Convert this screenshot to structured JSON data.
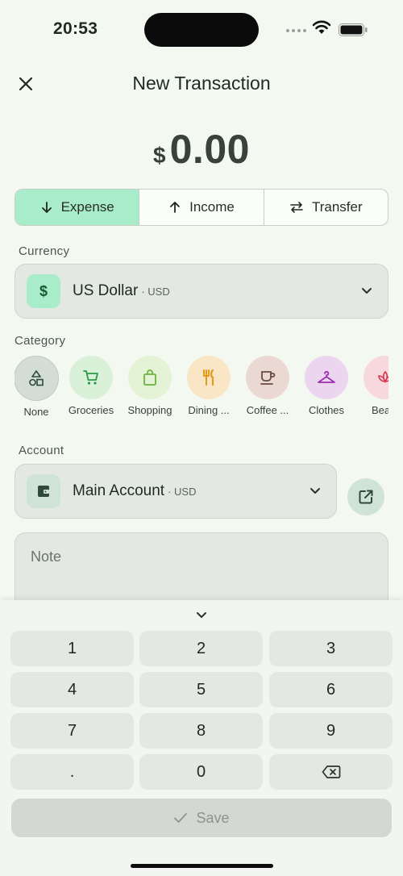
{
  "status": {
    "time": "20:53"
  },
  "header": {
    "title": "New Transaction",
    "close_icon": "close-icon"
  },
  "amount": {
    "currency_symbol": "$",
    "value": "0.00"
  },
  "types": [
    {
      "label": "Expense",
      "icon": "arrow-down-icon",
      "active": true
    },
    {
      "label": "Income",
      "icon": "arrow-up-icon",
      "active": false
    },
    {
      "label": "Transfer",
      "icon": "swap-arrows-icon",
      "active": false
    }
  ],
  "currency": {
    "label": "Currency",
    "name": "US Dollar",
    "code": "· USD",
    "symbol": "$"
  },
  "category": {
    "label": "Category",
    "items": [
      {
        "name": "None",
        "icon": "shapes-icon"
      },
      {
        "name": "Groceries",
        "icon": "cart-icon"
      },
      {
        "name": "Shopping",
        "icon": "shopping-bag-icon"
      },
      {
        "name": "Dining ...",
        "icon": "fork-knife-icon"
      },
      {
        "name": "Coffee ...",
        "icon": "coffee-cup-icon"
      },
      {
        "name": "Clothes",
        "icon": "hanger-icon"
      },
      {
        "name": "Beaut",
        "icon": "lotus-icon"
      }
    ]
  },
  "account": {
    "label": "Account",
    "name": "Main Account",
    "code": "· USD"
  },
  "note": {
    "placeholder": "Note"
  },
  "keypad": {
    "keys": [
      "1",
      "2",
      "3",
      "4",
      "5",
      "6",
      "7",
      "8",
      "9",
      ".",
      "0",
      ""
    ],
    "save_label": "Save"
  },
  "colors": {
    "accent": "#a9ecc9",
    "background": "#f3f9f1"
  }
}
